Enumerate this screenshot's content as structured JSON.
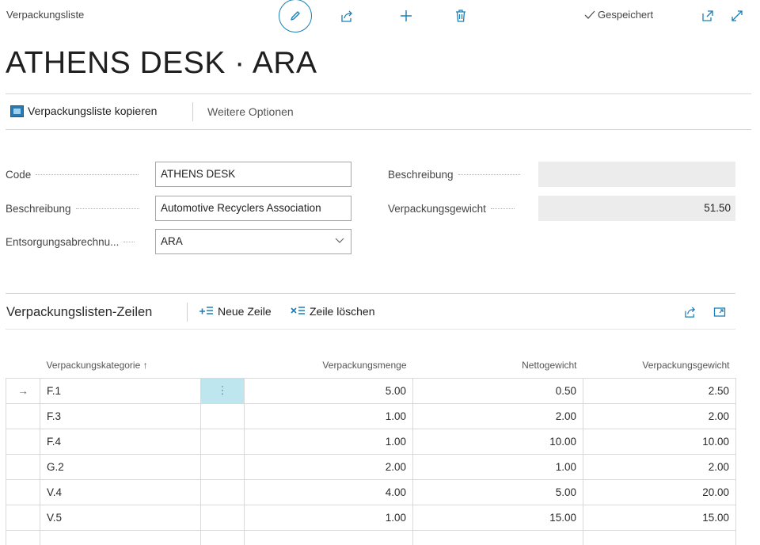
{
  "header": {
    "breadcrumb": "Verpackungsliste",
    "saved_status": "Gespeichert",
    "title": "ATHENS DESK · ARA",
    "icons": [
      "edit-icon",
      "share-icon",
      "add-icon",
      "delete-icon",
      "checkmark-icon",
      "popout-icon",
      "expand-icon"
    ]
  },
  "actions": {
    "copy_label": "Verpackungsliste kopieren",
    "more_label": "Weitere Optionen"
  },
  "form": {
    "code_label": "Code",
    "code_value": "ATHENS DESK",
    "desc_label": "Beschreibung",
    "desc_value": "Automotive Recyclers Association",
    "billing_label": "Entsorgungsabrechnu...",
    "billing_value": "ARA",
    "right_desc_label": "Beschreibung",
    "right_desc_value": "",
    "weight_label": "Verpackungsgewicht",
    "weight_value": "51.50"
  },
  "lines": {
    "title": "Verpackungslisten-Zeilen",
    "new_line_label": "Neue Zeile",
    "delete_line_label": "Zeile löschen",
    "columns": {
      "category": "Verpackungskategorie ↑",
      "quantity": "Verpackungsmenge",
      "net": "Nettogewicht",
      "pack": "Verpackungsgewicht"
    },
    "rows": [
      {
        "indicator": "→",
        "category": "F.1",
        "menu": "⋮",
        "quantity": "5.00",
        "net": "0.50",
        "pack": "2.50"
      },
      {
        "indicator": "",
        "category": "F.3",
        "menu": "",
        "quantity": "1.00",
        "net": "2.00",
        "pack": "2.00"
      },
      {
        "indicator": "",
        "category": "F.4",
        "menu": "",
        "quantity": "1.00",
        "net": "10.00",
        "pack": "10.00"
      },
      {
        "indicator": "",
        "category": "G.2",
        "menu": "",
        "quantity": "2.00",
        "net": "1.00",
        "pack": "2.00"
      },
      {
        "indicator": "",
        "category": "V.4",
        "menu": "",
        "quantity": "4.00",
        "net": "5.00",
        "pack": "20.00"
      },
      {
        "indicator": "",
        "category": "V.5",
        "menu": "",
        "quantity": "1.00",
        "net": "15.00",
        "pack": "15.00"
      },
      {
        "indicator": "",
        "category": "",
        "menu": "",
        "quantity": "",
        "net": "",
        "pack": ""
      }
    ]
  },
  "colors": {
    "accent": "#1a7fb8",
    "active_cell": "#bde6ef"
  }
}
